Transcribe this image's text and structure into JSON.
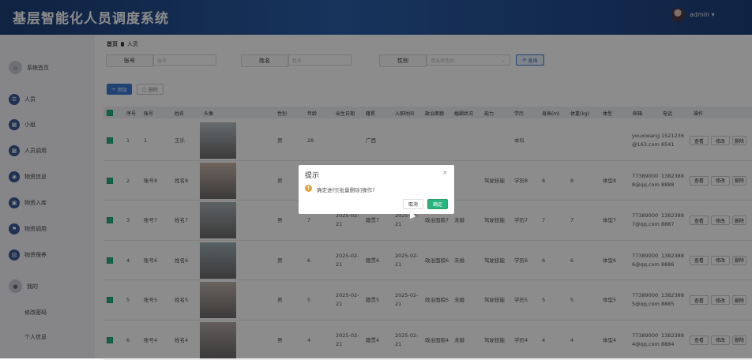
{
  "header": {
    "title": "基层智能化人员调度系统",
    "username": "admin ▾"
  },
  "sidebar": {
    "items": [
      {
        "label": "系统首页",
        "icon": "home-icon"
      },
      {
        "label": "人员",
        "icon": "list-icon"
      },
      {
        "label": "小组",
        "icon": "grid-icon"
      },
      {
        "label": "人员调用",
        "icon": "grid-icon"
      },
      {
        "label": "物资信息",
        "icon": "location-icon"
      },
      {
        "label": "物资入库",
        "icon": "lock-icon"
      },
      {
        "label": "物资调用",
        "icon": "flag-icon"
      },
      {
        "label": "物资保养",
        "icon": "briefcase-icon"
      },
      {
        "label": "我的",
        "icon": "user-icon"
      }
    ],
    "sub_items": [
      "修改密码",
      "个人信息"
    ]
  },
  "breadcrumb": {
    "home": "首页",
    "current": "人员"
  },
  "filters": {
    "account_label": "账号",
    "account_placeholder": "账号",
    "name_label": "姓名",
    "name_placeholder": "姓名",
    "gender_label": "性别",
    "gender_placeholder": "请选择性别",
    "search_button": "查询"
  },
  "toolbar": {
    "add": "添加",
    "delete": "删除"
  },
  "table": {
    "headers": [
      "序号",
      "账号",
      "姓名",
      "头像",
      "性别",
      "年龄",
      "出生日期",
      "籍贯",
      "入职时间",
      "政治面貌",
      "婚姻状况",
      "能力",
      "学历",
      "身高(m)",
      "体重(kg)",
      "体型",
      "邮箱",
      "电话",
      "操作"
    ],
    "rows": [
      {
        "idx": "1",
        "account": "1",
        "name": "王乐",
        "gender": "男",
        "age": "28",
        "birth": "",
        "origin": "广西",
        "hire": "",
        "political": "",
        "marital": "",
        "ability": "",
        "edu": "本科",
        "height": "",
        "weight": "",
        "body": "",
        "email": "youxiwang@163.com",
        "phone": "15212366541"
      },
      {
        "idx": "2",
        "account": "账号8",
        "name": "姓名8",
        "gender": "男",
        "age": "",
        "birth": "",
        "origin": "",
        "hire": "",
        "political": "",
        "marital": "",
        "ability": "驾驶技能",
        "edu": "学历8",
        "height": "8",
        "weight": "8",
        "body": "体型8",
        "email": "773890008@qq.com",
        "phone": "13823888888"
      },
      {
        "idx": "3",
        "account": "账号7",
        "name": "姓名7",
        "gender": "男",
        "age": "7",
        "birth": "2025-02-21",
        "origin": "籍贯7",
        "hire": "2025-02-21",
        "political": "政治面貌7",
        "marital": "未婚",
        "ability": "驾驶技能",
        "edu": "学历7",
        "height": "7",
        "weight": "7",
        "body": "体型7",
        "email": "773890007@qq.com",
        "phone": "13823888887"
      },
      {
        "idx": "4",
        "account": "账号6",
        "name": "姓名6",
        "gender": "男",
        "age": "6",
        "birth": "2025-02-21",
        "origin": "籍贯6",
        "hire": "2025-02-21",
        "political": "政治面貌6",
        "marital": "未婚",
        "ability": "驾驶技能",
        "edu": "学历6",
        "height": "6",
        "weight": "6",
        "body": "体型6",
        "email": "773890006@qq.com",
        "phone": "13823888886"
      },
      {
        "idx": "5",
        "account": "账号5",
        "name": "姓名5",
        "gender": "男",
        "age": "5",
        "birth": "2025-02-21",
        "origin": "籍贯5",
        "hire": "2025-02-21",
        "political": "政治面貌5",
        "marital": "未婚",
        "ability": "驾驶技能",
        "edu": "学历5",
        "height": "5",
        "weight": "5",
        "body": "体型5",
        "email": "773890005@qq.com",
        "phone": "13823888885"
      },
      {
        "idx": "6",
        "account": "账号4",
        "name": "姓名4",
        "gender": "男",
        "age": "4",
        "birth": "2025-02-21",
        "origin": "籍贯4",
        "hire": "2025-02-21",
        "political": "政治面貌4",
        "marital": "未婚",
        "ability": "驾驶技能",
        "edu": "学历4",
        "height": "4",
        "weight": "4",
        "body": "体型4",
        "email": "773890004@qq.com",
        "phone": "13823888884"
      }
    ],
    "actions": [
      "查看",
      "修改",
      "删除"
    ]
  },
  "dialog": {
    "title": "提示",
    "close": "×",
    "message": "确定进行[批量删除]操作?",
    "cancel": "取消",
    "confirm": "确定"
  },
  "colors": {
    "header": "#2c5ea8",
    "accent": "#2ab37e",
    "warning": "#e6a23c"
  }
}
